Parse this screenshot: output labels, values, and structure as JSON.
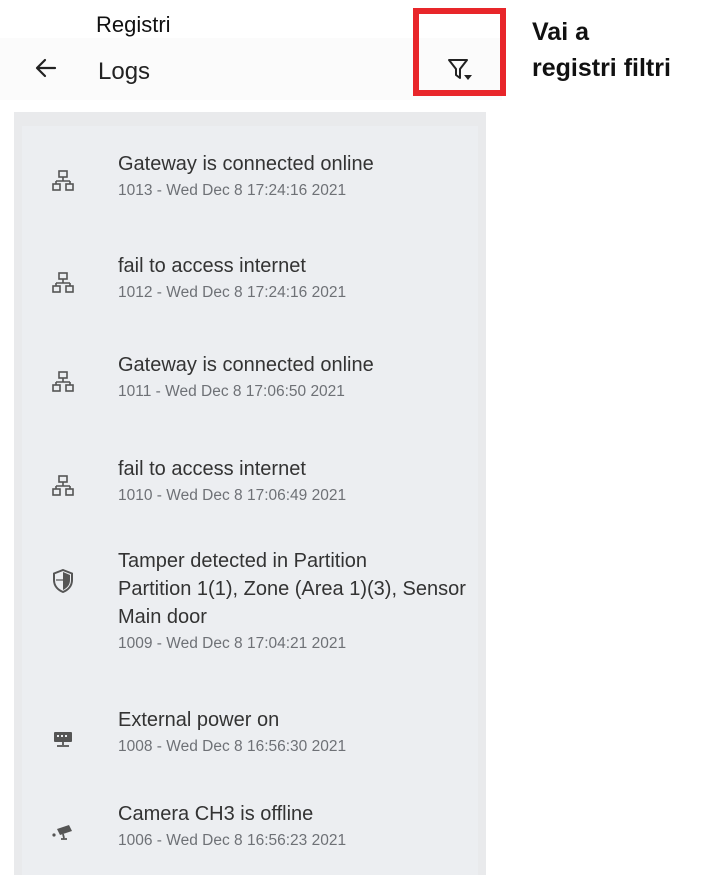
{
  "annotation": {
    "caption_top": "Registri",
    "callout_line1": "Vai a",
    "callout_line2": "registri filtri",
    "highlight_color": "#e8262a"
  },
  "appbar": {
    "title": "Logs",
    "back_icon": "arrow-left-icon",
    "filter_icon": "filter-dropdown-icon"
  },
  "logs": [
    {
      "title": "Gateway is connected online",
      "subtitle": "1013 - Wed Dec  8 17:24:16 2021",
      "icon": "network-icon"
    },
    {
      "title": "fail to access internet",
      "subtitle": "1012 - Wed Dec  8 17:24:16 2021",
      "icon": "network-icon"
    },
    {
      "title": "Gateway is connected online",
      "subtitle": "1011 - Wed Dec  8 17:06:50 2021",
      "icon": "network-icon"
    },
    {
      "title": "fail to access internet",
      "subtitle": "1010 - Wed Dec  8 17:06:49 2021",
      "icon": "network-icon"
    },
    {
      "title_lines": [
        "Tamper detected in Partition",
        "Partition 1(1), Zone (Area 1)(3), Sensor",
        "Main door"
      ],
      "subtitle": "1009 - Wed Dec  8 17:04:21 2021",
      "icon": "shield-icon"
    },
    {
      "title": "External power on",
      "subtitle": "1008 - Wed Dec  8 16:56:30 2021",
      "icon": "power-supply-icon"
    },
    {
      "title": "Camera CH3 is offline",
      "subtitle": "1006 - Wed Dec  8 16:56:23 2021",
      "icon": "camera-icon"
    }
  ]
}
